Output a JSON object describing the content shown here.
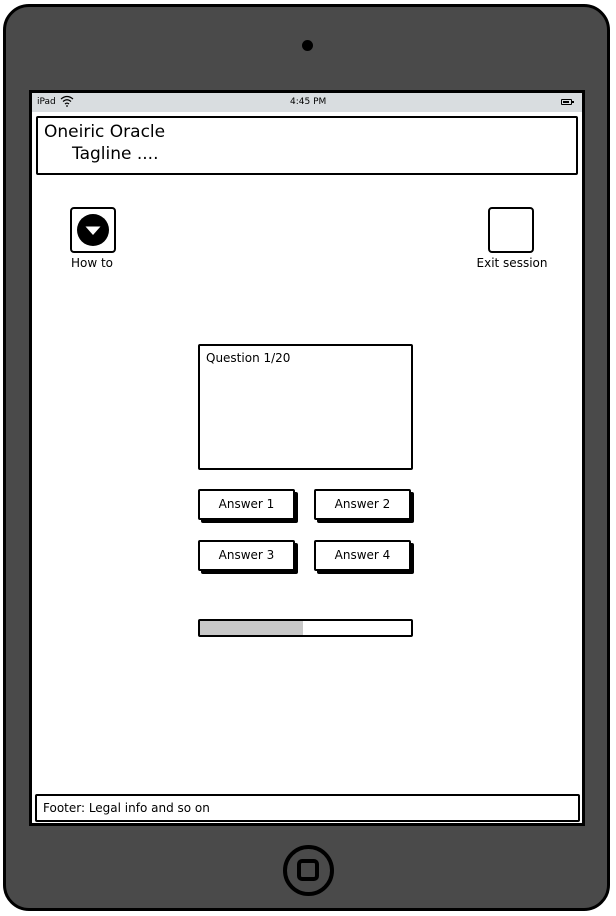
{
  "status_bar": {
    "carrier": "iPad",
    "time": "4:45 PM",
    "wifi_icon": "wifi-icon",
    "battery_icon": "battery-icon"
  },
  "header": {
    "title": "Oneiric Oracle",
    "tagline": "Tagline ...."
  },
  "toolbar": {
    "how_to_label": "How to",
    "how_to_icon": "chevron-down-circle-icon",
    "exit_label": "Exit session"
  },
  "quiz": {
    "question_label": "Question 1/20",
    "answers": [
      "Answer 1",
      "Answer 2",
      "Answer 3",
      "Answer 4"
    ],
    "progress_fraction": 0.49
  },
  "footer": {
    "text": "Footer: Legal info and so on"
  },
  "colors": {
    "device_bezel": "#4a4a4a",
    "status_bar": "#d9dde0",
    "progress_fill": "#c8c8c8"
  }
}
